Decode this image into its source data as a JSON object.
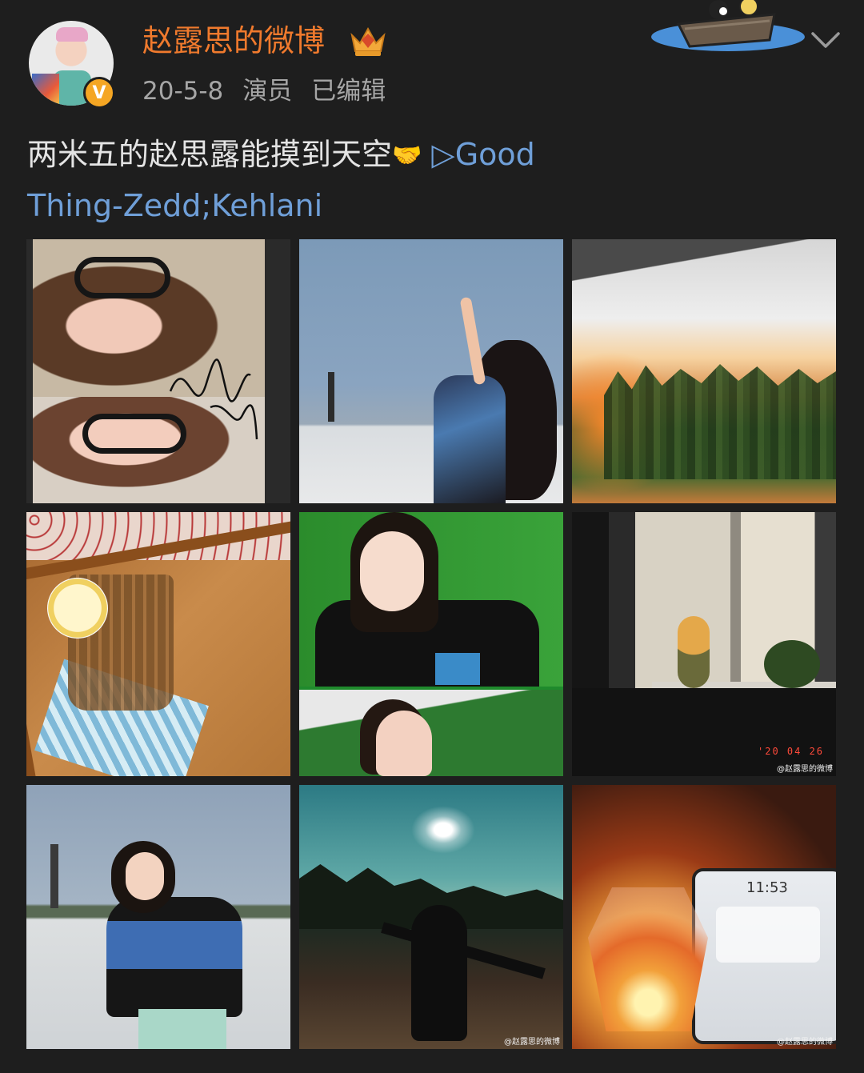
{
  "header": {
    "username": "赵露思的微博",
    "date": "20-5-8",
    "role": "演员",
    "edited": "已编辑",
    "vip_icon": "crown-gem-icon",
    "verified_icon": "verified-v-icon",
    "verified_badge": "V",
    "collapse_icon": "chevron-down-icon",
    "decoration_icon": "boat-cats-icon"
  },
  "post": {
    "text": "两米五的赵思露能摸到天空",
    "emoji": "🤝",
    "music_link": "▷Good Thing-Zedd;Kehlani"
  },
  "images": {
    "date_stamp": "'20 04 26",
    "watermark_6": "@赵露思的微博",
    "watermark_8": "@赵露思的微博",
    "watermark_9": "@赵露思的微博",
    "tablet_time": "11:53"
  },
  "colors": {
    "username": "#f07a2d",
    "link": "#6f9fd8",
    "background": "#1e1e1e",
    "verified": "#f5a623"
  }
}
